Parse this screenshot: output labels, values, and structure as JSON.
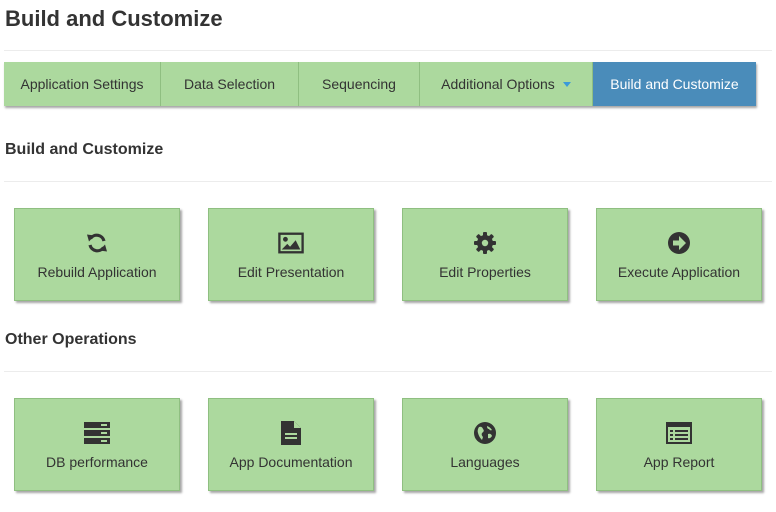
{
  "header": {
    "title": "Build and Customize"
  },
  "tabs": [
    {
      "label": "Application Settings",
      "active": false
    },
    {
      "label": "Data Selection",
      "active": false
    },
    {
      "label": "Sequencing",
      "active": false
    },
    {
      "label": "Additional Options",
      "active": false,
      "dropdown": true
    },
    {
      "label": "Build and Customize",
      "active": true
    }
  ],
  "sections": [
    {
      "title": "Build and Customize",
      "tiles": [
        {
          "label": "Rebuild Application",
          "icon": "refresh-icon"
        },
        {
          "label": "Edit Presentation",
          "icon": "image-icon"
        },
        {
          "label": "Edit Properties",
          "icon": "gear-icon"
        },
        {
          "label": "Execute Application",
          "icon": "arrow-circle-right-icon"
        }
      ]
    },
    {
      "title": "Other Operations",
      "tiles": [
        {
          "label": "DB performance",
          "icon": "server-icon"
        },
        {
          "label": "App Documentation",
          "icon": "document-icon"
        },
        {
          "label": "Languages",
          "icon": "globe-icon"
        },
        {
          "label": "App Report",
          "icon": "report-list-icon"
        }
      ]
    }
  ],
  "colors": {
    "tile_bg": "#acd99e",
    "active_tab_bg": "#4a8cba",
    "caret": "#3a9ad9",
    "icon": "#333333"
  }
}
